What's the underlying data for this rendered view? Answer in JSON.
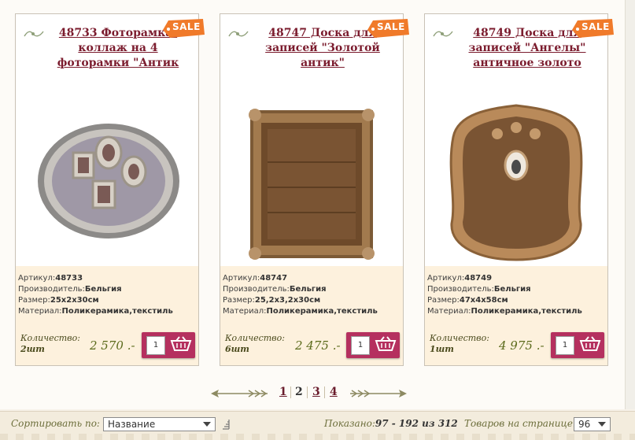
{
  "products": [
    {
      "title": "48733 Фоторамка-коллаж на 4 фоторамки \"Антик",
      "sale": "SALE",
      "article_label": "Артикул:",
      "article": "48733",
      "maker_label": "Производитель:",
      "maker": "Бельгия",
      "size_label": "Размер:",
      "size": "25x2x30см",
      "material_label": "Материал:",
      "material": "Поликерамика,текстиль",
      "qty_label": "Количество:",
      "qty": "2шт",
      "price": "2 570 .-",
      "input_qty": "1"
    },
    {
      "title": "48747 Доска для записей \"Золотой антик\"",
      "sale": "SALE",
      "article_label": "Артикул:",
      "article": "48747",
      "maker_label": "Производитель:",
      "maker": "Бельгия",
      "size_label": "Размер:",
      "size": "25,2x3,2x30см",
      "material_label": "Материал:",
      "material": "Поликерамика,текстиль",
      "qty_label": "Количество:",
      "qty": "6шт",
      "price": "2 475 .-",
      "input_qty": "1"
    },
    {
      "title": "48749 Доска для записей \"Ангелы\" античное золото",
      "sale": "SALE",
      "article_label": "Артикул:",
      "article": "48749",
      "maker_label": "Производитель:",
      "maker": "Бельгия",
      "size_label": "Размер:",
      "size": "47x4x58см",
      "material_label": "Материал:",
      "material": "Поликерамика,текстиль",
      "qty_label": "Количество:",
      "qty": "1шт",
      "price": "4 975 .-",
      "input_qty": "1"
    }
  ],
  "pagination": {
    "pages": [
      "1",
      "2",
      "3",
      "4"
    ],
    "current": "2"
  },
  "toolbar": {
    "sort_label": "Сортировать по:",
    "sort_value": "Название",
    "shown_label": "Показано:",
    "shown_value": "97 - 192 из 312",
    "per_page_label": "Товаров на странице:",
    "per_page_value": "96"
  },
  "colors": {
    "title_link": "#7b1c2e",
    "price": "#5b6a1b",
    "buy_button": "#b5305f",
    "sale_tag": "#f07a2a",
    "specs_bg": "#fdf1dd"
  }
}
